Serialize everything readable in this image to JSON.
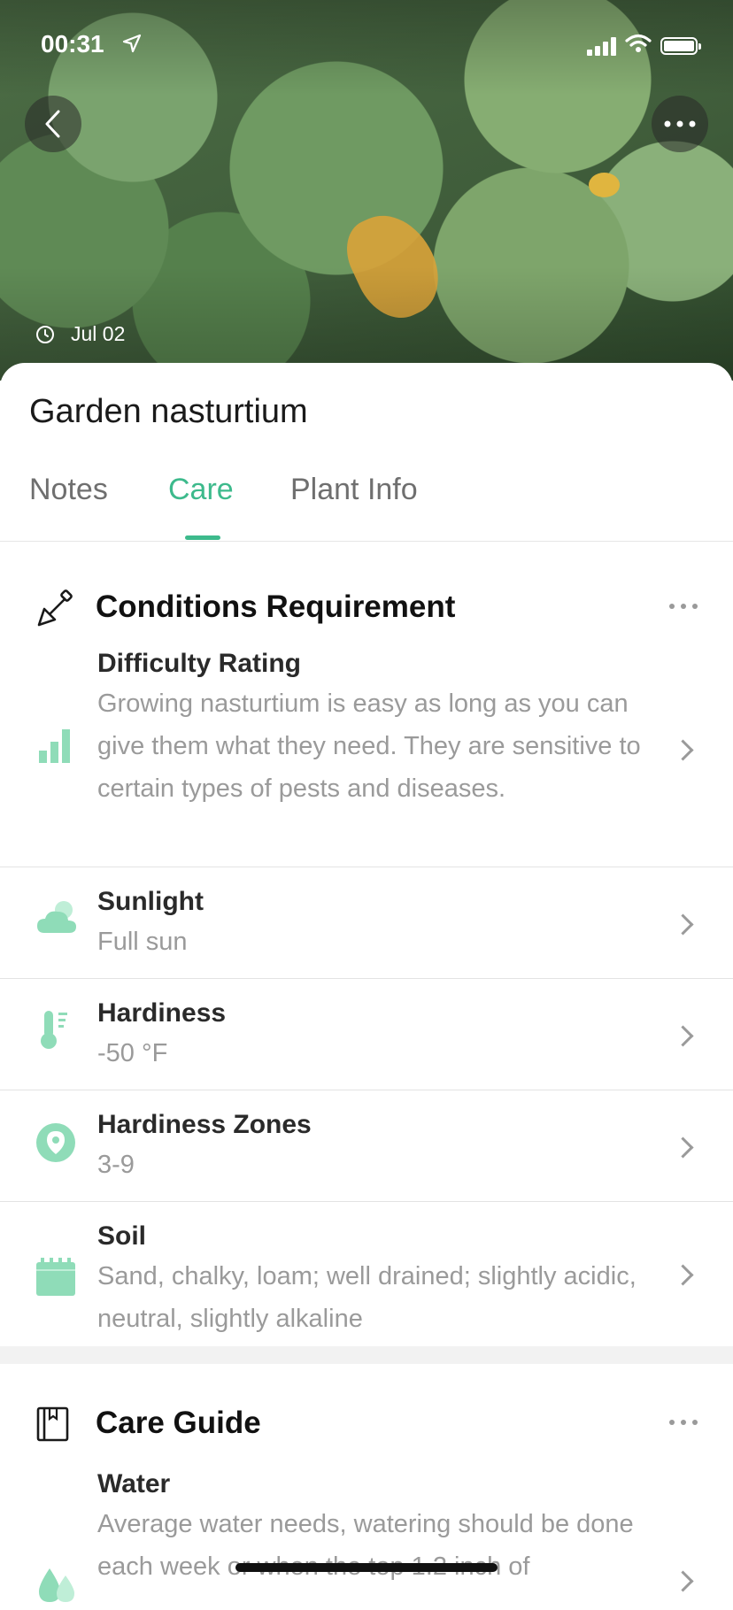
{
  "status_bar": {
    "time": "00:31"
  },
  "hero": {
    "date": "Jul 02"
  },
  "plant": {
    "name": "Garden nasturtium"
  },
  "tabs": [
    {
      "label": "Notes",
      "active": false
    },
    {
      "label": "Care",
      "active": true
    },
    {
      "label": "Plant Info",
      "active": false
    }
  ],
  "conditions": {
    "title": "Conditions Requirement",
    "icon": "trowel-icon",
    "items": [
      {
        "icon": "difficulty-bars-icon",
        "title": "Difficulty Rating",
        "value": "Growing nasturtium is easy as long as you can give them what they need. They are sensitive to certain types of pests and diseases."
      },
      {
        "icon": "sun-cloud-icon",
        "title": "Sunlight",
        "value": "Full sun"
      },
      {
        "icon": "thermometer-icon",
        "title": "Hardiness",
        "value": "-50 °F"
      },
      {
        "icon": "location-pin-icon",
        "title": "Hardiness Zones",
        "value": "3-9"
      },
      {
        "icon": "soil-icon",
        "title": "Soil",
        "value": "Sand, chalky, loam; well drained; slightly acidic, neutral, slightly alkaline"
      }
    ]
  },
  "care_guide": {
    "title": "Care Guide",
    "icon": "book-icon",
    "items": [
      {
        "icon": "water-drops-icon",
        "title": "Water",
        "value": "Average water needs, watering should be done each week or when the top 1.2 inch of"
      }
    ]
  },
  "colors": {
    "accent": "#3dba8c",
    "icon_green": "#8fdcb8",
    "text_muted": "#9a9a9a"
  }
}
